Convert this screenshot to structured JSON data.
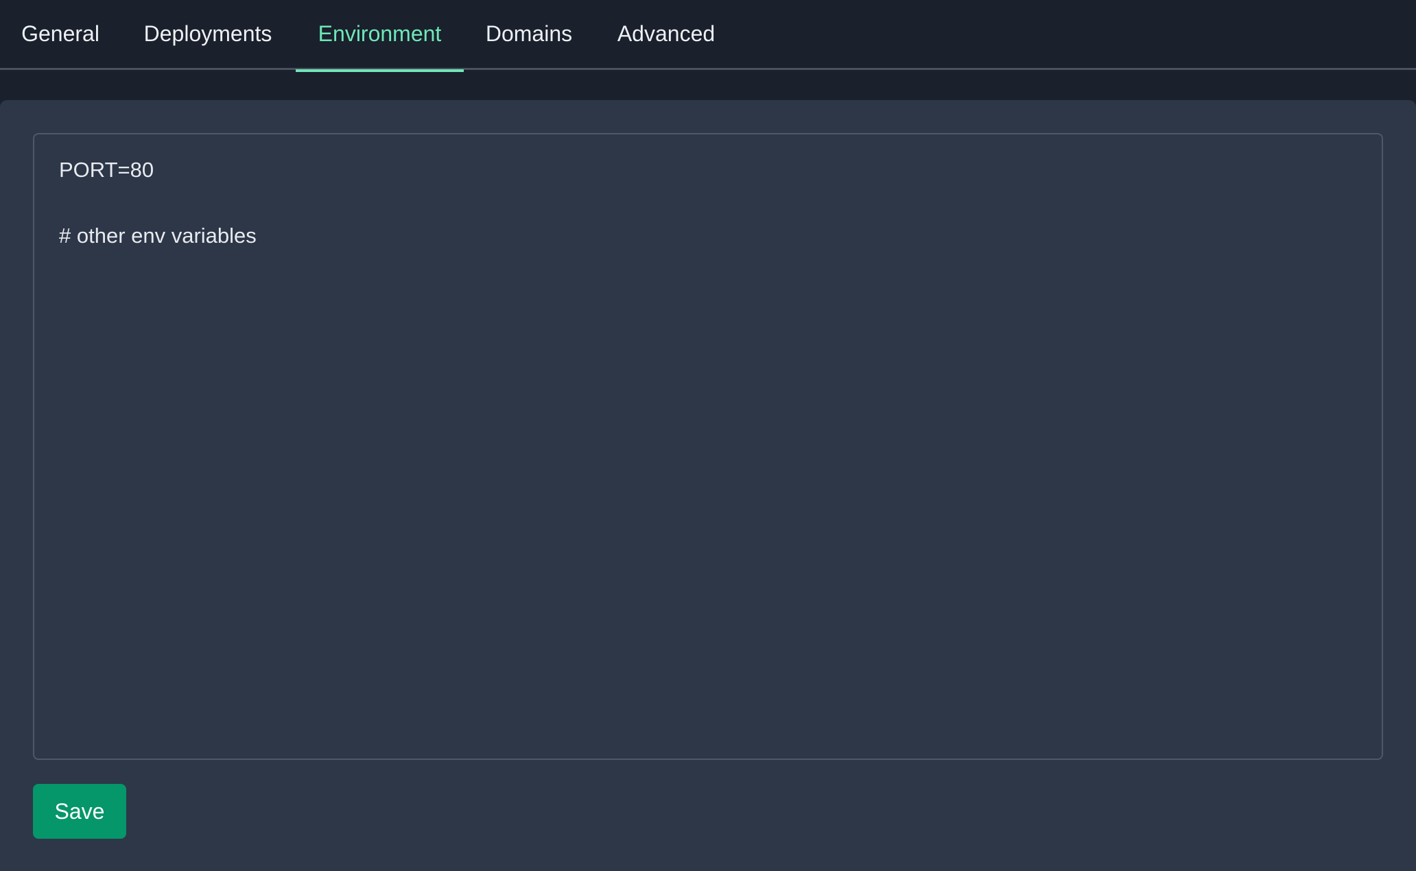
{
  "tabs": [
    {
      "label": "General",
      "active": false
    },
    {
      "label": "Deployments",
      "active": false
    },
    {
      "label": "Environment",
      "active": true
    },
    {
      "label": "Domains",
      "active": false
    },
    {
      "label": "Advanced",
      "active": false
    }
  ],
  "editor": {
    "value": "PORT=80\n\n# other env variables"
  },
  "actions": {
    "save_label": "Save"
  },
  "colors": {
    "accent": "#6ee7b7",
    "save_button": "#059669",
    "panel": "#2d3748",
    "background": "#1a202c"
  }
}
